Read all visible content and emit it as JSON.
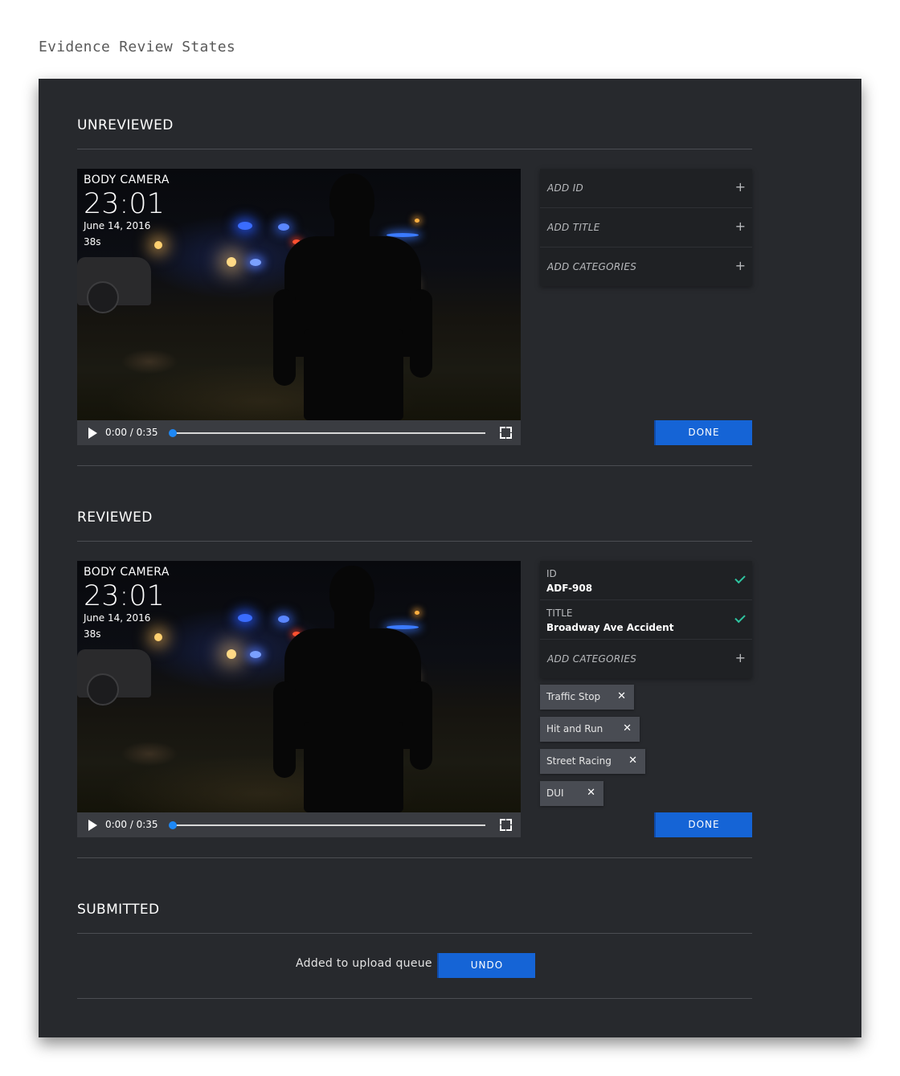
{
  "page": {
    "heading": "Evidence Review States"
  },
  "colors": {
    "panel_bg": "#27292d",
    "accent": "#1564d6",
    "check": "#2ec4a0",
    "progress": "#1e88f5"
  },
  "sections": {
    "unreviewed": {
      "title": "UNREVIEWED",
      "video": {
        "source": "BODY CAMERA",
        "time": "23:01",
        "date": "June 14, 2016",
        "length": "38s",
        "timecode": "0:00 / 0:35",
        "progress": 0
      },
      "fields": [
        {
          "label": "ADD ID",
          "icon": "plus-icon"
        },
        {
          "label": "ADD TITLE",
          "icon": "plus-icon"
        },
        {
          "label": "ADD CATEGORIES",
          "icon": "plus-icon"
        }
      ],
      "done_label": "DONE"
    },
    "reviewed": {
      "title": "REVIEWED",
      "video": {
        "source": "BODY CAMERA",
        "time": "23:01",
        "date": "June 14, 2016",
        "length": "38s",
        "timecode": "0:00 / 0:35",
        "progress": 0
      },
      "id_field": {
        "label": "ID",
        "value": "ADF-908",
        "icon": "check-icon"
      },
      "title_field": {
        "label": "TITLE",
        "value": "Broadway Ave Accident",
        "icon": "check-icon"
      },
      "categories_field": {
        "label": "ADD CATEGORIES",
        "icon": "plus-icon"
      },
      "tags": [
        "Traffic Stop",
        "Hit and Run",
        "Street Racing",
        "DUI"
      ],
      "done_label": "DONE"
    },
    "submitted": {
      "title": "SUBMITTED",
      "message": "Added to upload queue",
      "undo_label": "UNDO"
    }
  }
}
